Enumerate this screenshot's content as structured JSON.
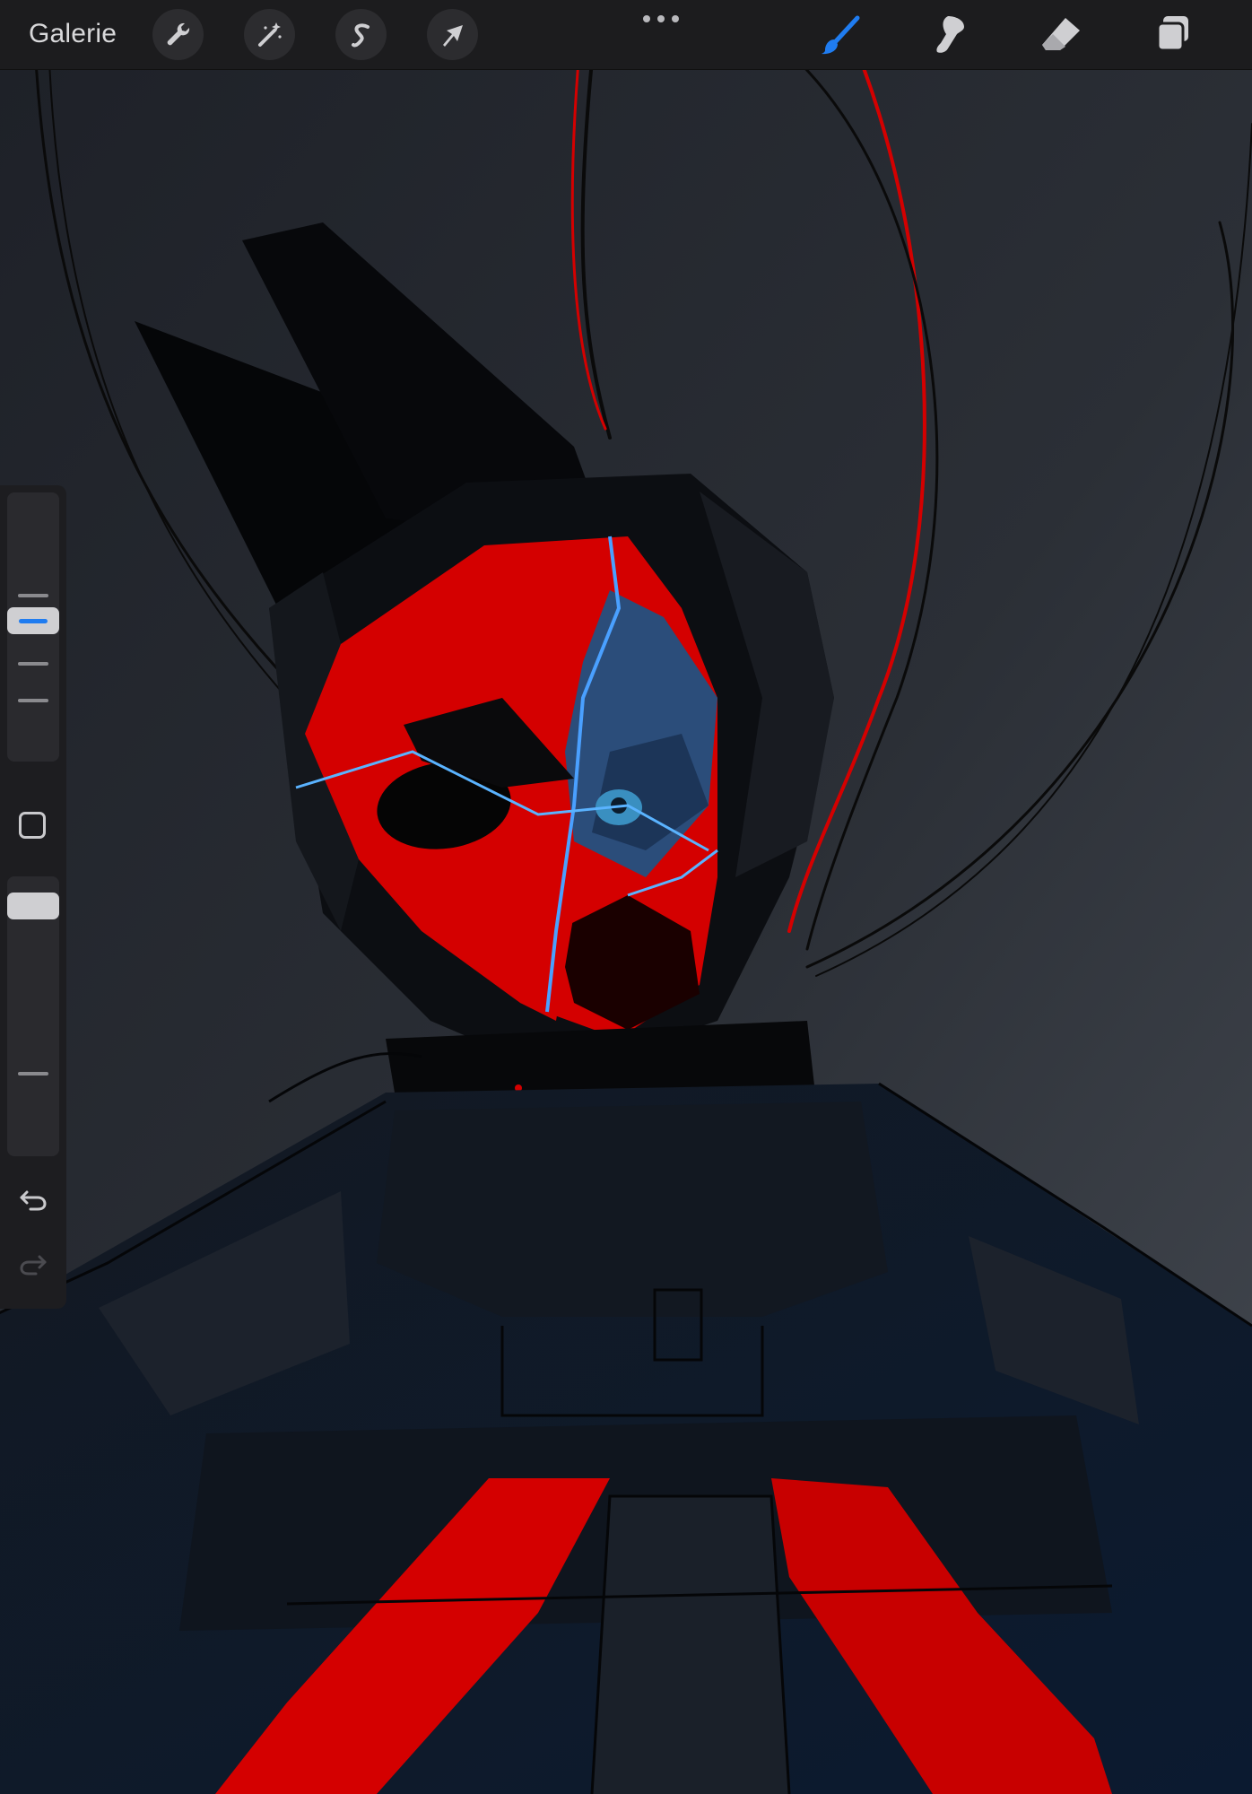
{
  "topbar": {
    "gallery_label": "Galerie",
    "left_tools": [
      {
        "name": "actions",
        "icon": "wrench-icon"
      },
      {
        "name": "adjustments",
        "icon": "magic-wand-icon"
      },
      {
        "name": "selection",
        "icon": "selection-s-icon"
      },
      {
        "name": "transform",
        "icon": "arrow-cursor-icon"
      }
    ],
    "more_icon": "ellipsis-icon",
    "right_tools": [
      {
        "name": "brush",
        "icon": "brush-icon",
        "active": true
      },
      {
        "name": "smudge",
        "icon": "smudge-icon",
        "active": false
      },
      {
        "name": "eraser",
        "icon": "eraser-icon",
        "active": false
      },
      {
        "name": "layers",
        "icon": "layers-icon",
        "active": false
      }
    ]
  },
  "sidebar": {
    "brush_size_level": 0.57,
    "brush_opacity_level": 1.0,
    "modify_icon": "square-icon",
    "undo_icon": "undo-icon",
    "redo_icon": "redo-icon",
    "redo_enabled": false
  },
  "colors": {
    "toolbar_bg": "#1c1c1e",
    "accent_blue": "#1f7cf0",
    "mask_red": "#d40000",
    "canvas_bg_top": "#1f2329",
    "canvas_bg_bottom": "#3a3f47"
  }
}
